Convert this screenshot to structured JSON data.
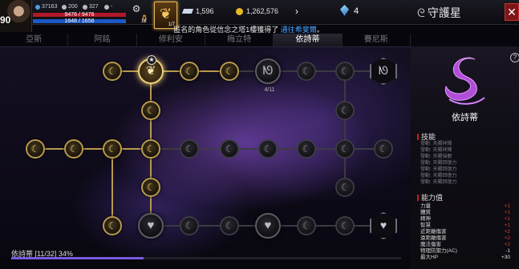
{
  "player": {
    "level": "90",
    "hp": "9476 / 9476",
    "mp": "1648 / 1656",
    "stat1": "37163",
    "stat2": "200",
    "stat3": "327",
    "stat4": "-"
  },
  "items": {
    "potion_count": "12",
    "feather_count": "1/7"
  },
  "currency": {
    "gems": "1,596",
    "gold": "1,262,576",
    "crystals": "4"
  },
  "window": {
    "title": "守護星",
    "close": "✕"
  },
  "notice": {
    "text": "匿名的角色從信念之塔1樓獲得了 ",
    "link": "通往希斐爾",
    "tail": "。"
  },
  "tabs": [
    "亞斯",
    "阿銘",
    "修利安",
    "梅立特",
    "依詩蒂",
    "賽尼斯"
  ],
  "active_tab": "依詩蒂",
  "board": {
    "progress": "依詩蒂 [11/32] 34%",
    "glyph_count": "4/11",
    "progress_fraction": 0.34
  },
  "panel": {
    "name": "依詩蒂",
    "skills_title": "技能",
    "skills": [
      "發動: 天賜祥輝",
      "發動: 天賜祥輝",
      "發動: 天賜強韌",
      "發動: 天賜回復力",
      "發動: 天賜回復力",
      "發動: 天賜回復力",
      "發動: 天賜回復力"
    ],
    "ability_title": "能力值",
    "abilities": [
      {
        "name": "力量",
        "value": "+1"
      },
      {
        "name": "體質",
        "value": "+1"
      },
      {
        "name": "精神",
        "value": "+1"
      },
      {
        "name": "智慧",
        "value": "+1"
      },
      {
        "name": "近距離傷害",
        "value": "+2"
      },
      {
        "name": "遠距離傷害",
        "value": "+2"
      },
      {
        "name": "魔法傷害",
        "value": "+2"
      },
      {
        "name": "物理防禦力(AC)",
        "value": "-1"
      },
      {
        "name": "最大HP",
        "value": "+30"
      }
    ]
  },
  "icons": {
    "node": "crescent-moon-icon",
    "glyph": "swan-icon",
    "heart": "heart-icon",
    "feather": "feather-icon"
  }
}
